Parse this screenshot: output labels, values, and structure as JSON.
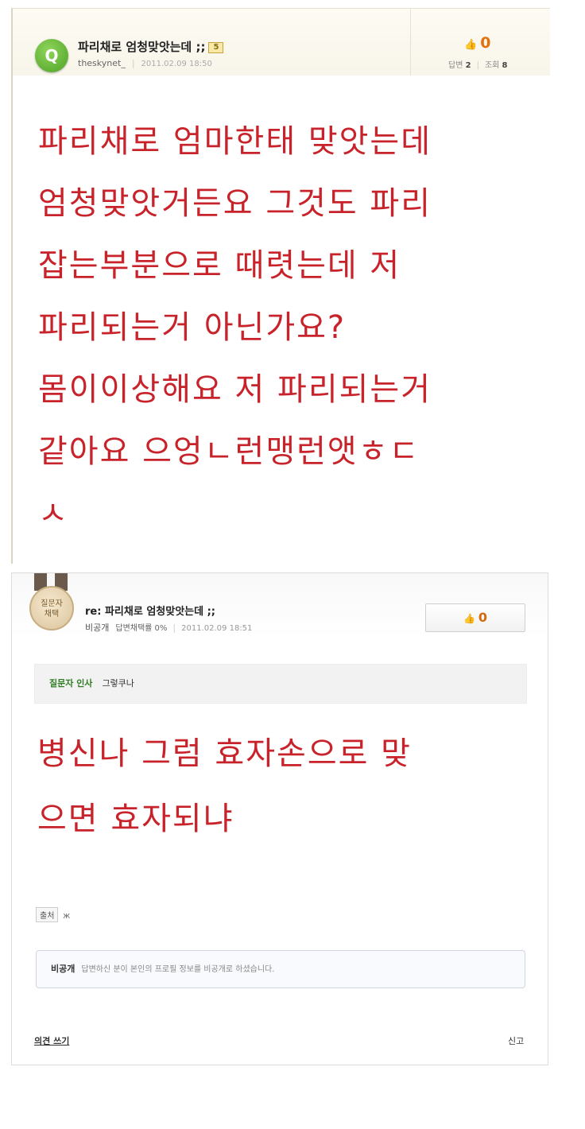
{
  "question": {
    "badge": "Q",
    "title": "파리채로 엄청맞앗는데 ;;",
    "bounty": "5",
    "author": "theskynet_",
    "date": "2011.02.09 18:50",
    "likes": "0",
    "answers_label": "답변",
    "answers_count": "2",
    "views_label": "조회",
    "views_count": "8",
    "body_lines": [
      "파리채로 엄마한태 맞앗는데",
      "엄청맞앗거든요 그것도 파리",
      "잡는부분으로 때렷는데 저",
      "파리되는거 아닌가요?",
      "몸이이상해요 저 파리되는거",
      "같아요 으엉ㄴ런맹런앳ㅎㄷ",
      "ㅅ"
    ]
  },
  "answer": {
    "medal_line1": "질문자",
    "medal_line2": "채택",
    "title": "re: 파리채로 엄청맞앗는데 ;;",
    "author": "비공개",
    "adoption_rate": "답변채택률 0%",
    "date": "2011.02.09 18:51",
    "likes": "0",
    "greeting_label": "질문자 인사",
    "greeting_text": "그렇쿠나",
    "body_lines": [
      "병신나 그럼 효자손으로 맞",
      "으면 효자되냐"
    ],
    "source_label": "출처",
    "source_value": "Ж",
    "private_label": "비공개",
    "private_text": "답변하신 분이 본인의 프로필 정보를 비공개로 하셨습니다.",
    "comment_link": "의견 쓰기",
    "report_link": "신고"
  }
}
